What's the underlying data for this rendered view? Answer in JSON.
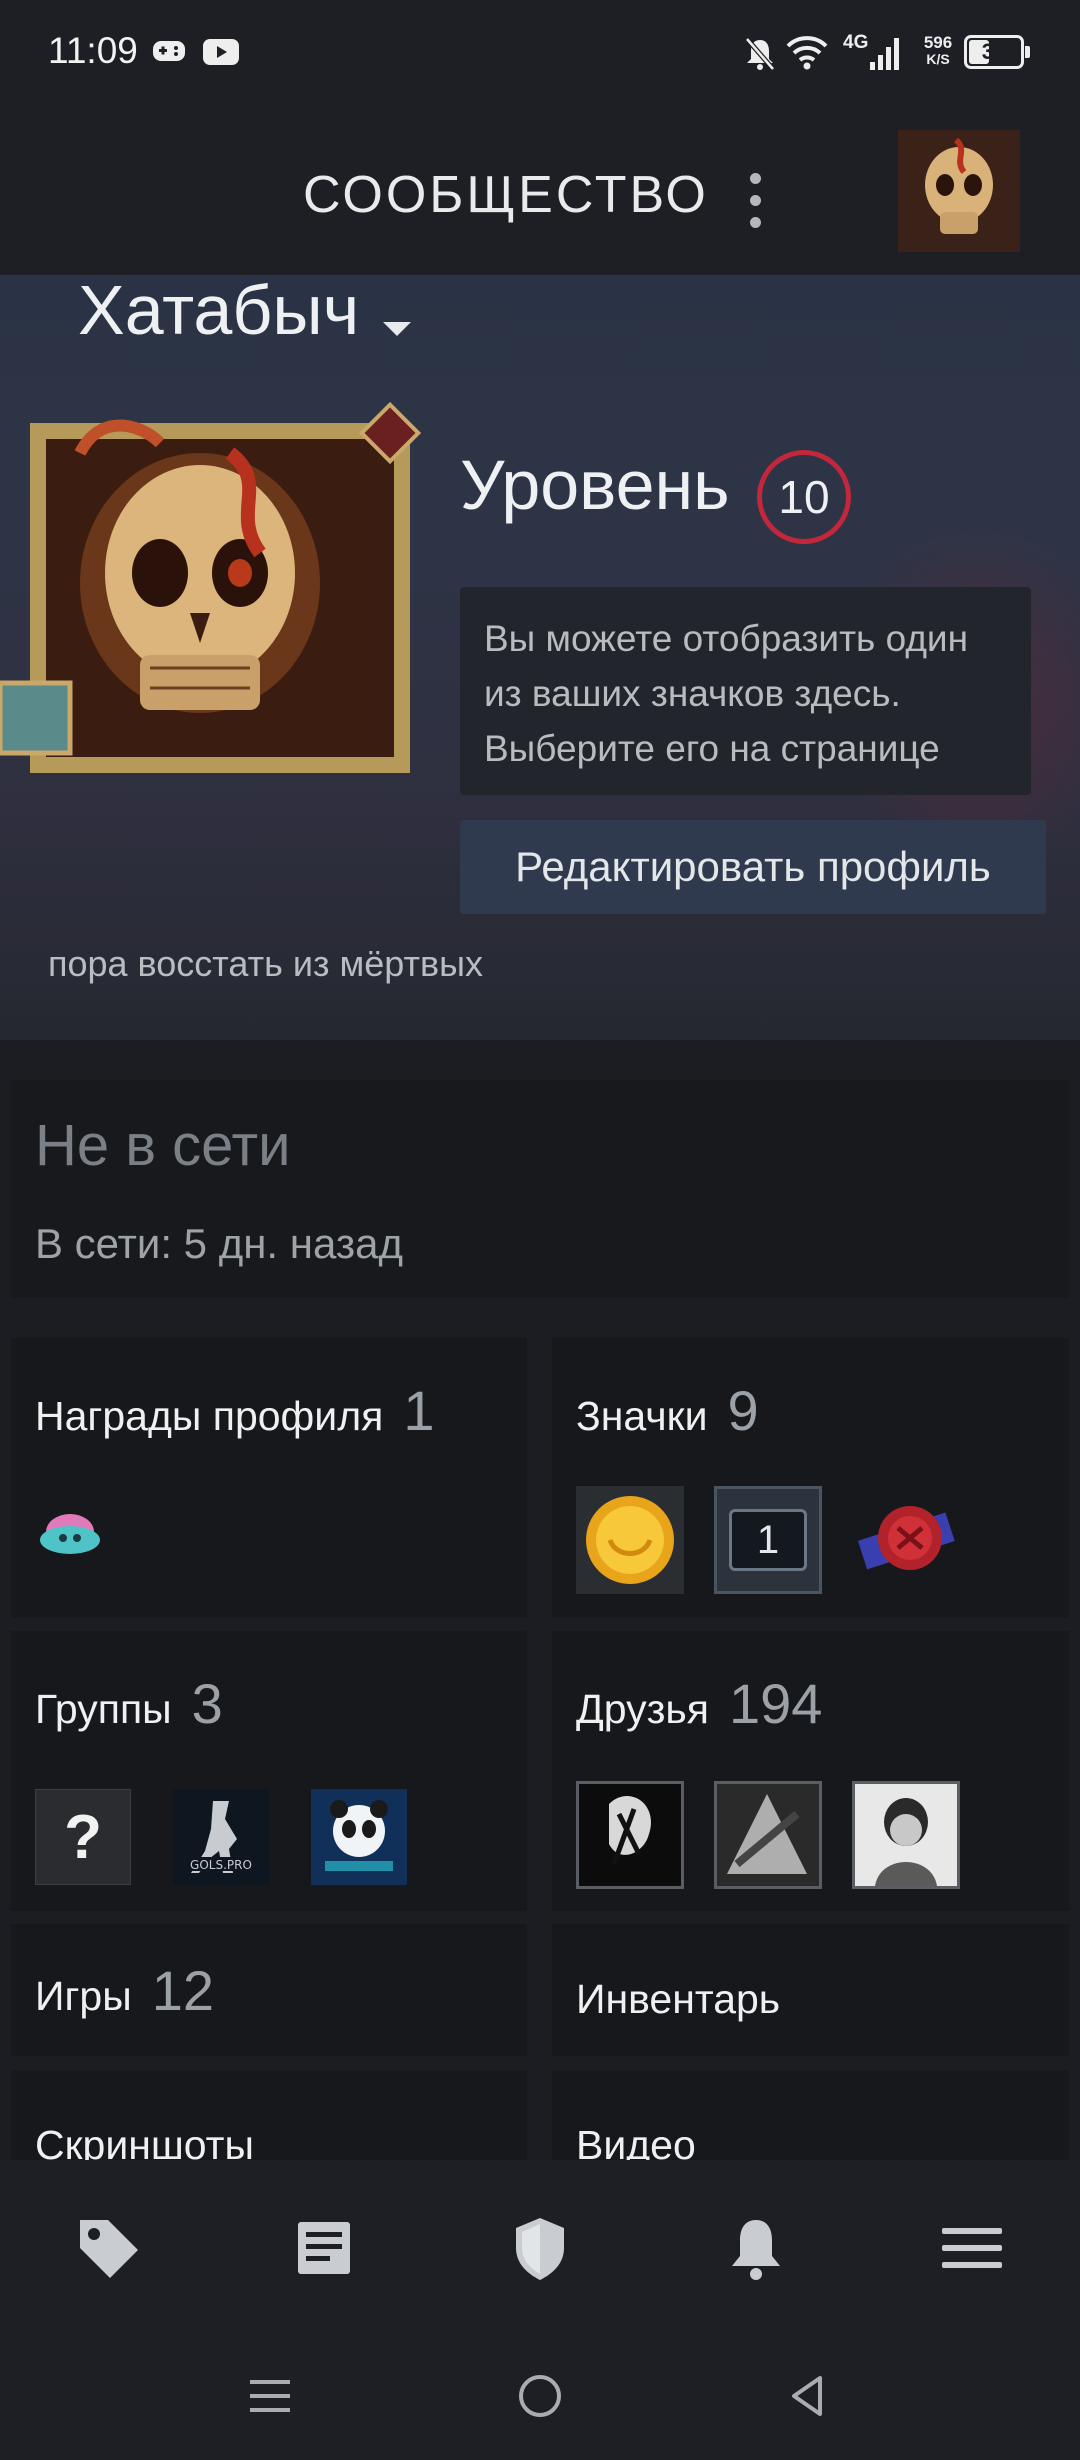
{
  "status_bar": {
    "time": "11:09",
    "network_type": "4G",
    "speed_value": "596",
    "speed_unit": "K/S",
    "battery": "36",
    "icons": [
      "gamepad-icon",
      "youtube-icon",
      "bell-off-icon",
      "wifi-icon",
      "signal-icon",
      "battery-icon"
    ]
  },
  "header": {
    "title": "СООБЩЕСТВО"
  },
  "profile": {
    "username": "Хатабыч",
    "level_label": "Уровень",
    "level": "10",
    "badge_tip": "Вы можете отобразить один из ваших значков здесь. Выберите его на странице",
    "edit_button": "Редактировать профиль",
    "summary": "пора восстать из мёртвых"
  },
  "presence": {
    "state": "Не в сети",
    "last_online": "В сети: 5 дн. назад"
  },
  "tiles": {
    "awards": {
      "title": "Награды профиля",
      "count": "1"
    },
    "badges": {
      "title": "Значки",
      "count": "9",
      "badge2_text": "1"
    },
    "groups": {
      "title": "Группы",
      "count": "3",
      "group1_text": "?"
    },
    "friends": {
      "title": "Друзья",
      "count": "194"
    },
    "games": {
      "title": "Игры",
      "count": "12"
    },
    "inventory": {
      "title": "Инвентарь"
    },
    "screenshots": {
      "title": "Скриншоты"
    },
    "videos": {
      "title": "Видео"
    }
  },
  "bottom_nav": {
    "items": [
      "tag-icon",
      "news-icon",
      "shield-icon",
      "bell-icon",
      "menu-icon"
    ]
  },
  "system_nav": {
    "items": [
      "recent-apps-icon",
      "home-icon",
      "back-icon"
    ]
  },
  "colors": {
    "level_ring": "#c3273c",
    "edit_button": "#2f3a4e",
    "tile_bg": "#16181c"
  }
}
